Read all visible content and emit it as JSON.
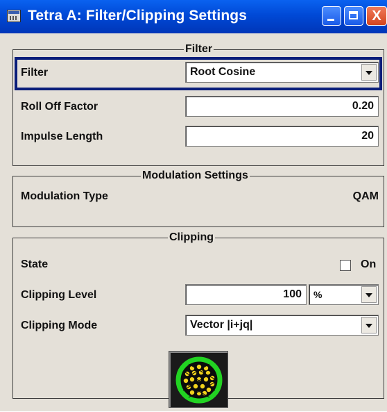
{
  "window": {
    "title": "Tetra A: Filter/Clipping Settings",
    "close_glyph": "X"
  },
  "filter": {
    "legend": "Filter",
    "filter_label": "Filter",
    "filter_value": "Root Cosine",
    "rolloff_label": "Roll Off Factor",
    "rolloff_value": "0.20",
    "impulse_label": "Impulse Length",
    "impulse_value": "20"
  },
  "modulation": {
    "legend": "Modulation Settings",
    "type_label": "Modulation Type",
    "type_value": "QAM"
  },
  "clipping": {
    "legend": "Clipping",
    "state_label": "State",
    "state_option": "On",
    "state_checked": false,
    "level_label": "Clipping Level",
    "level_value": "100",
    "level_unit": "%",
    "mode_label": "Clipping Mode",
    "mode_value": "Vector |i+jq|",
    "preview_icon": "constellation-clipping-icon"
  },
  "colors": {
    "titlebar": "#0049d6",
    "background": "#e4e0d8",
    "selected_border": "#0a1e7a",
    "clip_ring": "#22d322",
    "constellation_dots": "#f2d21c"
  }
}
